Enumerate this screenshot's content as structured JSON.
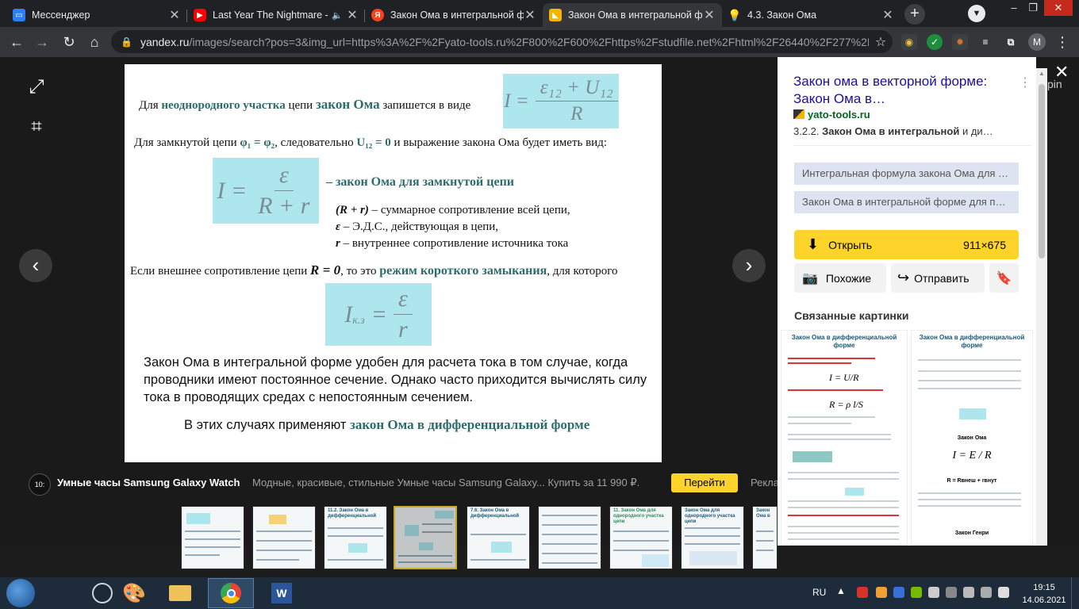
{
  "tabs": [
    {
      "title": "Мессенджер",
      "icon": "messenger-icon",
      "color": "#2d7ff9"
    },
    {
      "title": "Last Year The Nightmare -",
      "icon": "youtube-icon",
      "color": "#ff0000"
    },
    {
      "title": "Закон Ома в интегральной ф",
      "icon": "yandex-icon",
      "color": "#fc3f1d"
    },
    {
      "title": "Закон Ома в интегральной ф",
      "icon": "yandex-images-icon",
      "color": "#f5b400",
      "active": true
    },
    {
      "title": "4.3. Закон Ома",
      "icon": "bulb-icon",
      "color": "#f9c623"
    }
  ],
  "toolbar": {
    "url_host": "yandex.ru",
    "url_path": "/images/search?pos=3&img_url=https%3A%2F%2Fyato-tools.ru%2F800%2F600%2Fhttps%2Fstudfile.net%2Fhtml%2F26440%2F277%2F...",
    "profile_initial": "M"
  },
  "slide": {
    "line1_a": "Для ",
    "line1_b": "неоднородного участка",
    "line1_c": " цепи ",
    "line1_d": "закон Ома",
    "line1_e": " запишется в виде",
    "f1_lhs": "I =",
    "f1_num": "ε₁₂ + U₁₂",
    "f1_den": "R",
    "line2_a": "Для замкнутой цепи ",
    "line2_b": "φ₁ = φ₂",
    "line2_c": ", следовательно ",
    "line2_d": "U₁₂ = 0",
    "line2_e": " и выражение закона Ома будет иметь вид:",
    "f2_lhs": "I =",
    "f2_num": "ε",
    "f2_den": "R + r",
    "closed_label": "– закон Ома для замкнутой цепи",
    "def1_sym": "(R + r)",
    "def1_txt": " – суммарное сопротивление всей цепи,",
    "def2_sym": "ε",
    "def2_txt": " – Э.Д.С., действующая в цепи,",
    "def3_sym": "r",
    "def3_txt": " – внутреннее сопротивление источника тока",
    "line3_a": "Если внешнее сопротивление цепи ",
    "line3_b": "R = 0",
    "line3_c": ", то это ",
    "line3_d": "режим короткого замыкания",
    "line3_e": ", для которого",
    "f3_lhs": "I",
    "f3_sub": "к.з",
    "f3_eq": "=",
    "f3_num": "ε",
    "f3_den": "r",
    "para": "Закон Ома в интегральной форме удобен для расчета тока в том случае, когда проводники имеют постоянное сечение. Однако часто приходится вычислять силу тока в проводящих средах с непостоянным сечением.",
    "last_a": "В этих случаях применяют ",
    "last_b": "закон Ома в дифференциальной форме"
  },
  "ad": {
    "icon_text": "10:",
    "title": "Умные часы Samsung Galaxy Watch",
    "desc": "Модные, красивые, стильные Умные часы Samsung Galaxy... Купить за 11 990 ₽.",
    "go": "Перейти",
    "more": "Рекла"
  },
  "thumbs": [
    {
      "title": ""
    },
    {
      "title": ""
    },
    {
      "title": "11.2. Закон Ома в дифференциальной"
    },
    {
      "title": "",
      "selected": true
    },
    {
      "title": "7.6. Закон Ома в дифференциальной"
    },
    {
      "title": ""
    },
    {
      "title": "11. Закон Ома для однородного участка цепи"
    },
    {
      "title": "Закон Ома для однородного участка цепи"
    },
    {
      "title": "Закон Ома в"
    }
  ],
  "side": {
    "title": "Закон ома в векторной форме: Закон Ома в…",
    "site": "yato-tools.ru",
    "desc_a": "3.2.2. ",
    "desc_b": "Закон Ома в интегральной",
    "desc_c": " и ди…",
    "related_queries": [
      "Интегральная формула закона Ома для …",
      "Закон Ома в интегральной форме для п…"
    ],
    "open_label": "Открыть",
    "size": "911×675",
    "similar_label": "Похожие",
    "share_label": "Отправить",
    "related_title": "Связанные картинки",
    "cut_text": "pin",
    "rel1_title": "Закон Ома в дифференциальной форме",
    "rel2_title": "Закон Ома в дифференциальной форме",
    "rel2_caption": "Закон Ома",
    "rel2_formula": "I = E / R",
    "rel2_r": "R = Rвнеш + rвнут",
    "rel2_henry": "Закон Генри"
  },
  "taskbar": {
    "lang": "RU",
    "time": "19:15",
    "date": "14.06.2021"
  }
}
